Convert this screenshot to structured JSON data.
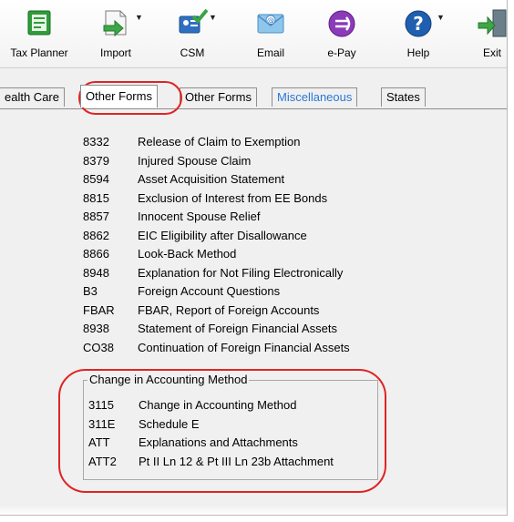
{
  "toolbar": {
    "items": [
      {
        "label": "Tax Planner",
        "icon": "tax-planner-icon"
      },
      {
        "label": "Import",
        "icon": "import-icon"
      },
      {
        "label": "CSM",
        "icon": "csm-icon"
      },
      {
        "label": "Email",
        "icon": "email-icon"
      },
      {
        "label": "e-Pay",
        "icon": "epay-icon"
      },
      {
        "label": "Help",
        "icon": "help-icon"
      },
      {
        "label": "Exit",
        "icon": "exit-icon"
      }
    ]
  },
  "tabs": [
    {
      "label": "ealth Care"
    },
    {
      "label": "Other Forms",
      "active": true
    },
    {
      "label": "Other Forms"
    },
    {
      "label": "Miscellaneous",
      "color": "#2a78d6"
    },
    {
      "label": "States"
    }
  ],
  "forms": [
    {
      "code": "8332",
      "name": "Release of Claim to Exemption"
    },
    {
      "code": "8379",
      "name": "Injured Spouse Claim"
    },
    {
      "code": "8594",
      "name": "Asset Acquisition Statement"
    },
    {
      "code": "8815",
      "name": "Exclusion of Interest from EE Bonds"
    },
    {
      "code": "8857",
      "name": "Innocent Spouse Relief"
    },
    {
      "code": "8862",
      "name": "EIC Eligibility after Disallowance"
    },
    {
      "code": "8866",
      "name": "Look-Back Method"
    },
    {
      "code": "8948",
      "name": "Explanation for Not Filing Electronically"
    },
    {
      "code": "B3",
      "name": "Foreign Account Questions"
    },
    {
      "code": "FBAR",
      "name": "FBAR, Report of Foreign Accounts"
    },
    {
      "code": "8938",
      "name": "Statement of Foreign Financial Assets"
    },
    {
      "code": "CO38",
      "name": "Continuation of Foreign Financial Assets"
    }
  ],
  "accounting_group": {
    "title": "Change in Accounting Method",
    "forms": [
      {
        "code": "3115",
        "name": "Change in Accounting Method"
      },
      {
        "code": "311E",
        "name": "Schedule E"
      },
      {
        "code": "ATT",
        "name": "Explanations and Attachments"
      },
      {
        "code": "ATT2",
        "name": "Pt II Ln 12 & Pt III Ln 23b Attachment"
      }
    ]
  },
  "colors": {
    "highlight": "#e02424",
    "link_blue": "#2a78d6"
  }
}
